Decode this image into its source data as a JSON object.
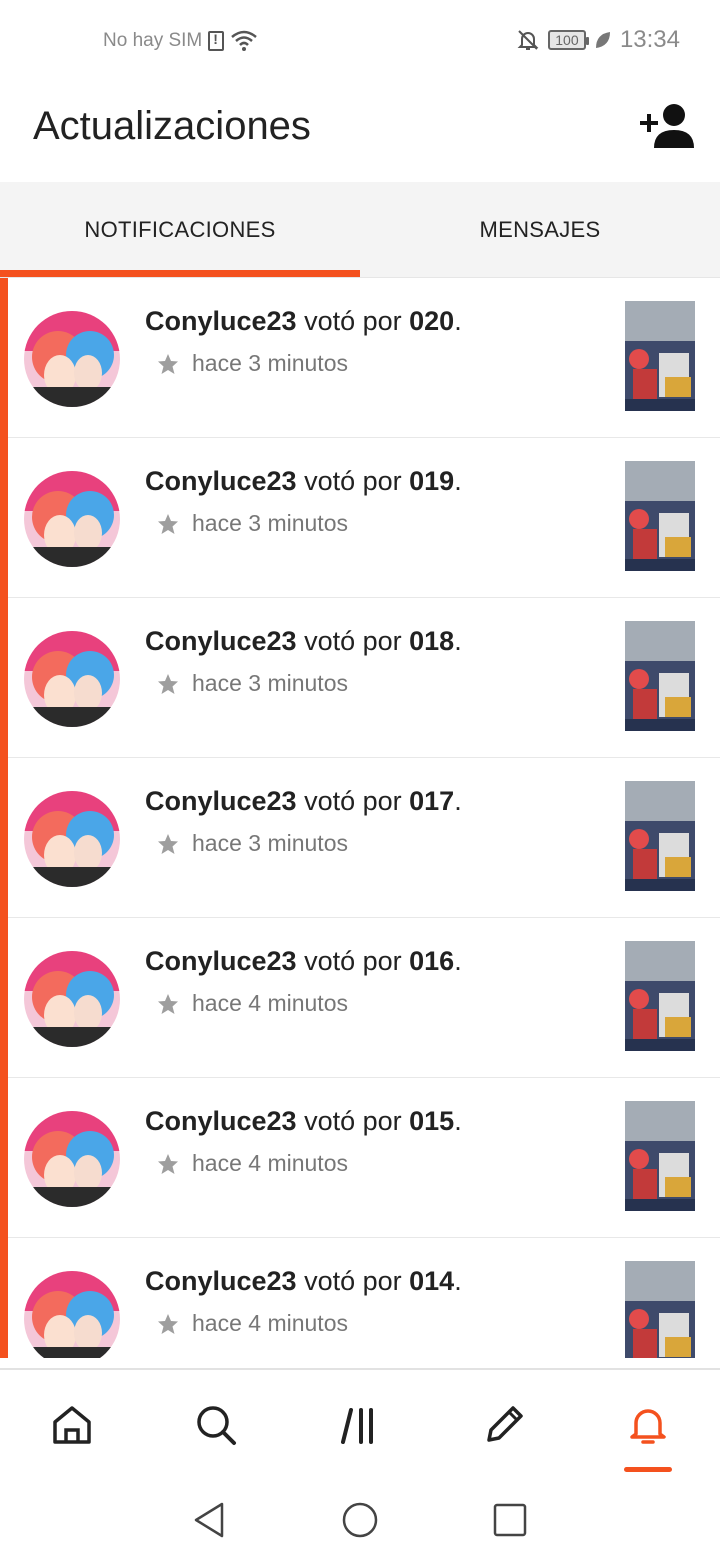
{
  "status_bar": {
    "carrier": "No hay SIM",
    "battery": "100",
    "time": "13:34"
  },
  "header": {
    "title": "Actualizaciones",
    "add_user_icon": "add-person-icon"
  },
  "tabs": [
    {
      "label": "NOTIFICACIONES",
      "active": true
    },
    {
      "label": "MENSAJES",
      "active": false
    }
  ],
  "notifications": [
    {
      "user": "Conyluce23",
      "action": " votó por ",
      "part": "020",
      "end": ".",
      "time": "hace 3 minutos"
    },
    {
      "user": "Conyluce23",
      "action": " votó por ",
      "part": "019",
      "end": ".",
      "time": "hace 3 minutos"
    },
    {
      "user": "Conyluce23",
      "action": " votó por ",
      "part": "018",
      "end": ".",
      "time": "hace 3 minutos"
    },
    {
      "user": "Conyluce23",
      "action": " votó por ",
      "part": "017",
      "end": ".",
      "time": "hace 3 minutos"
    },
    {
      "user": "Conyluce23",
      "action": " votó por ",
      "part": "016",
      "end": ".",
      "time": "hace 4 minutos"
    },
    {
      "user": "Conyluce23",
      "action": " votó por ",
      "part": "015",
      "end": ".",
      "time": "hace 4 minutos"
    },
    {
      "user": "Conyluce23",
      "action": " votó por ",
      "part": "014",
      "end": ".",
      "time": "hace 4 minutos"
    }
  ],
  "bottom_nav": [
    {
      "icon": "home-icon",
      "active": false
    },
    {
      "icon": "search-icon",
      "active": false
    },
    {
      "icon": "library-icon",
      "active": false
    },
    {
      "icon": "pencil-icon",
      "active": false
    },
    {
      "icon": "bell-icon",
      "active": true
    }
  ],
  "colors": {
    "accent": "#f4511e",
    "text": "#222222",
    "muted": "#777777",
    "tab_bg": "#f4f4f4"
  }
}
